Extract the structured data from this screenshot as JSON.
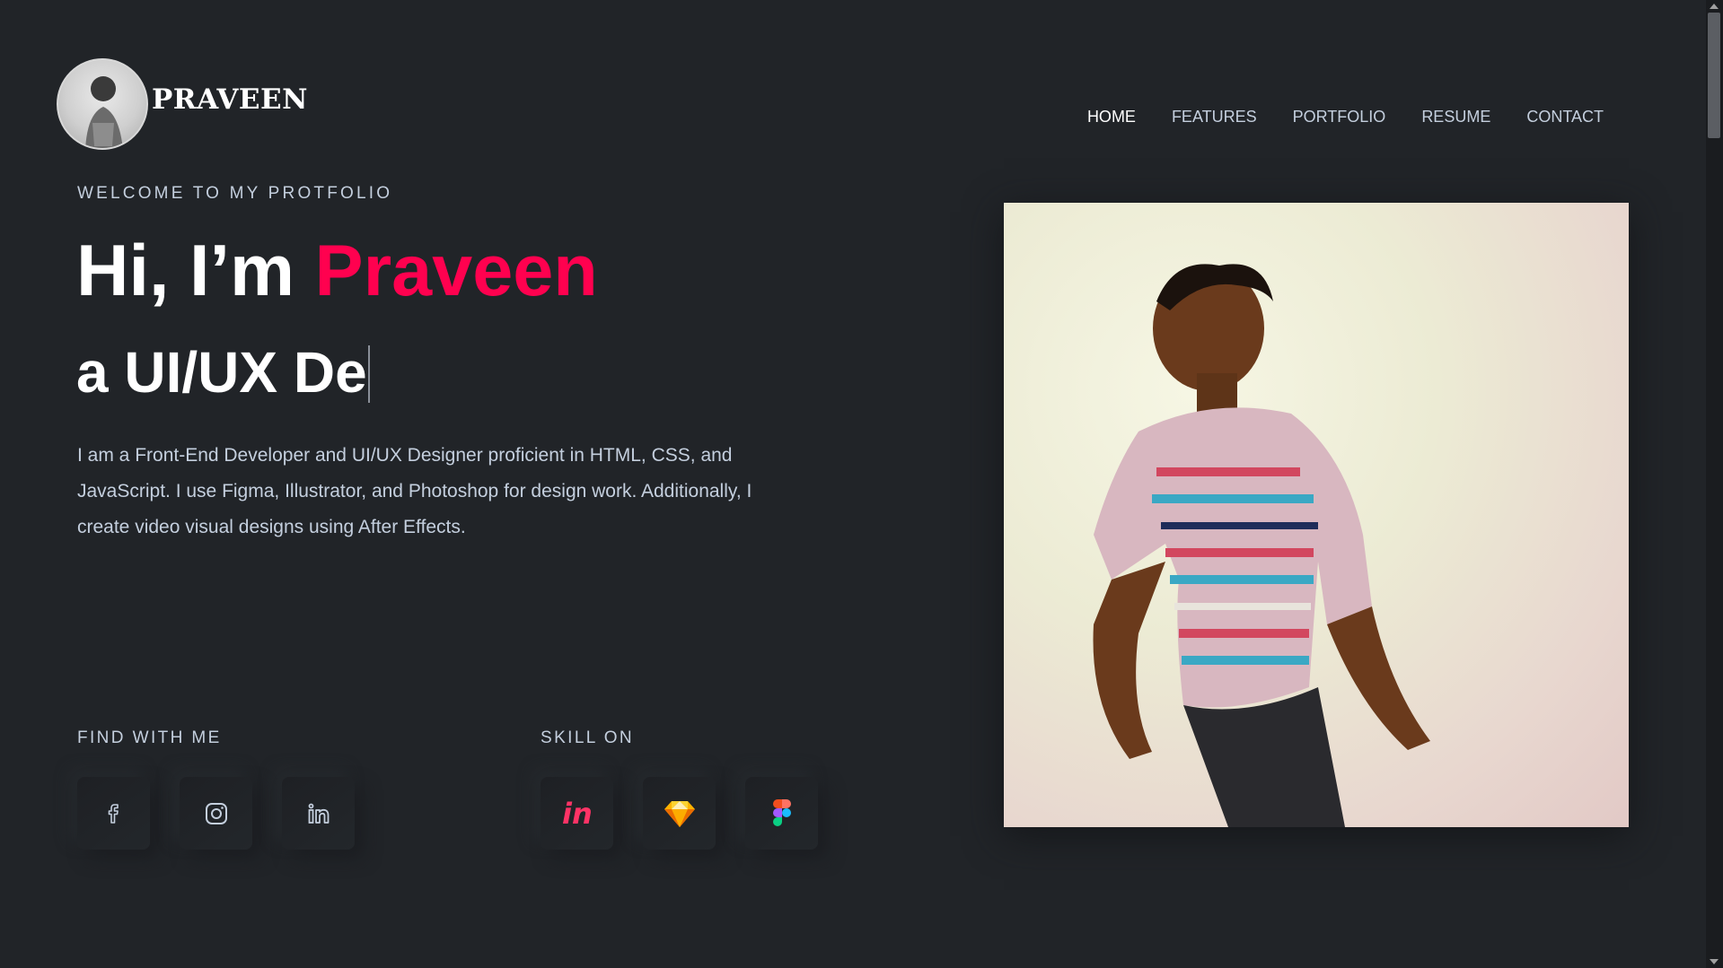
{
  "header": {
    "brand": "PRAVEEN",
    "nav": [
      "HOME",
      "FEATURES",
      "PORTFOLIO",
      "RESUME",
      "CONTACT"
    ],
    "active_nav": "HOME"
  },
  "hero": {
    "welcome": "WELCOME TO MY PROTFOLIO",
    "greeting": "Hi, I’m ",
    "name": "Praveen",
    "typing_text": "a UI/UX De",
    "description": "I am a Front-End Developer and UI/UX Designer proficient in HTML, CSS, and JavaScript. I use Figma, Illustrator, and Photoshop for design work. Additionally, I create video visual designs using After Effects."
  },
  "social": {
    "title": "FIND WITH ME",
    "icons": [
      "facebook-icon",
      "instagram-icon",
      "linkedin-icon"
    ]
  },
  "skills": {
    "title": "SKILL ON",
    "icons": [
      "invision-icon",
      "sketch-icon",
      "figma-icon"
    ]
  },
  "colors": {
    "background": "#212428",
    "accent": "#ff014f",
    "muted_text": "#c4cfde"
  }
}
